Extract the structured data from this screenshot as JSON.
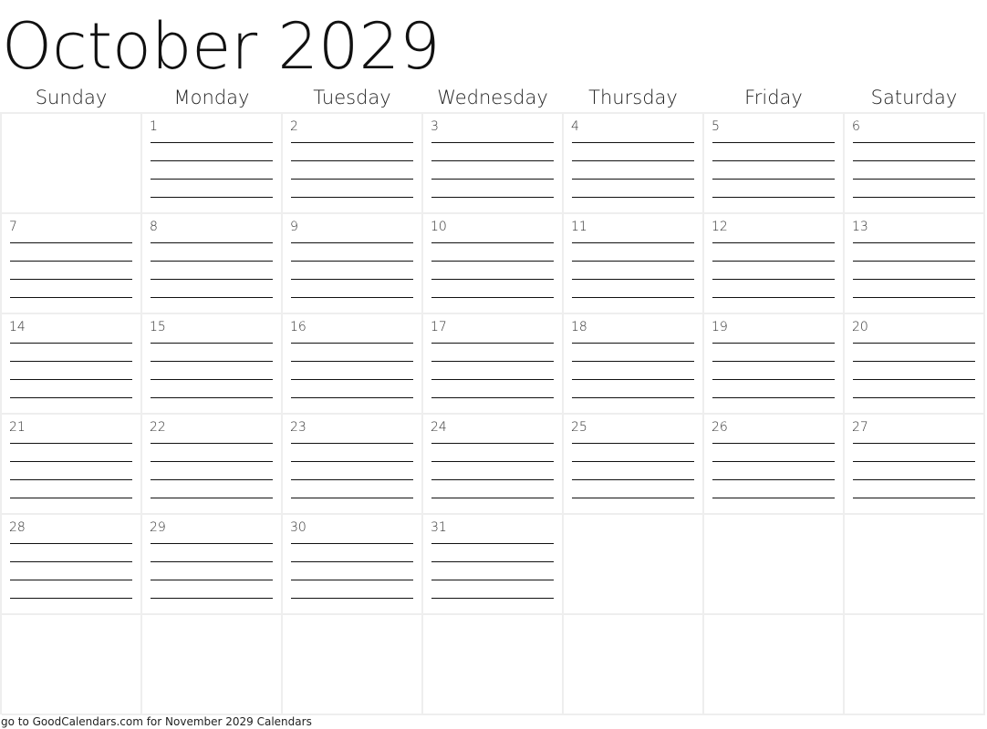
{
  "title": "October 2029",
  "weekdays": [
    "Sunday",
    "Monday",
    "Tuesday",
    "Wednesday",
    "Thursday",
    "Friday",
    "Saturday"
  ],
  "weeks": [
    [
      "",
      "1",
      "2",
      "3",
      "4",
      "5",
      "6"
    ],
    [
      "7",
      "8",
      "9",
      "10",
      "11",
      "12",
      "13"
    ],
    [
      "14",
      "15",
      "16",
      "17",
      "18",
      "19",
      "20"
    ],
    [
      "21",
      "22",
      "23",
      "24",
      "25",
      "26",
      "27"
    ],
    [
      "28",
      "29",
      "30",
      "31",
      "",
      "",
      ""
    ],
    [
      "",
      "",
      "",
      "",
      "",
      "",
      ""
    ]
  ],
  "lines_per_day": 4,
  "footer": "go to GoodCalendars.com for November 2029 Calendars"
}
